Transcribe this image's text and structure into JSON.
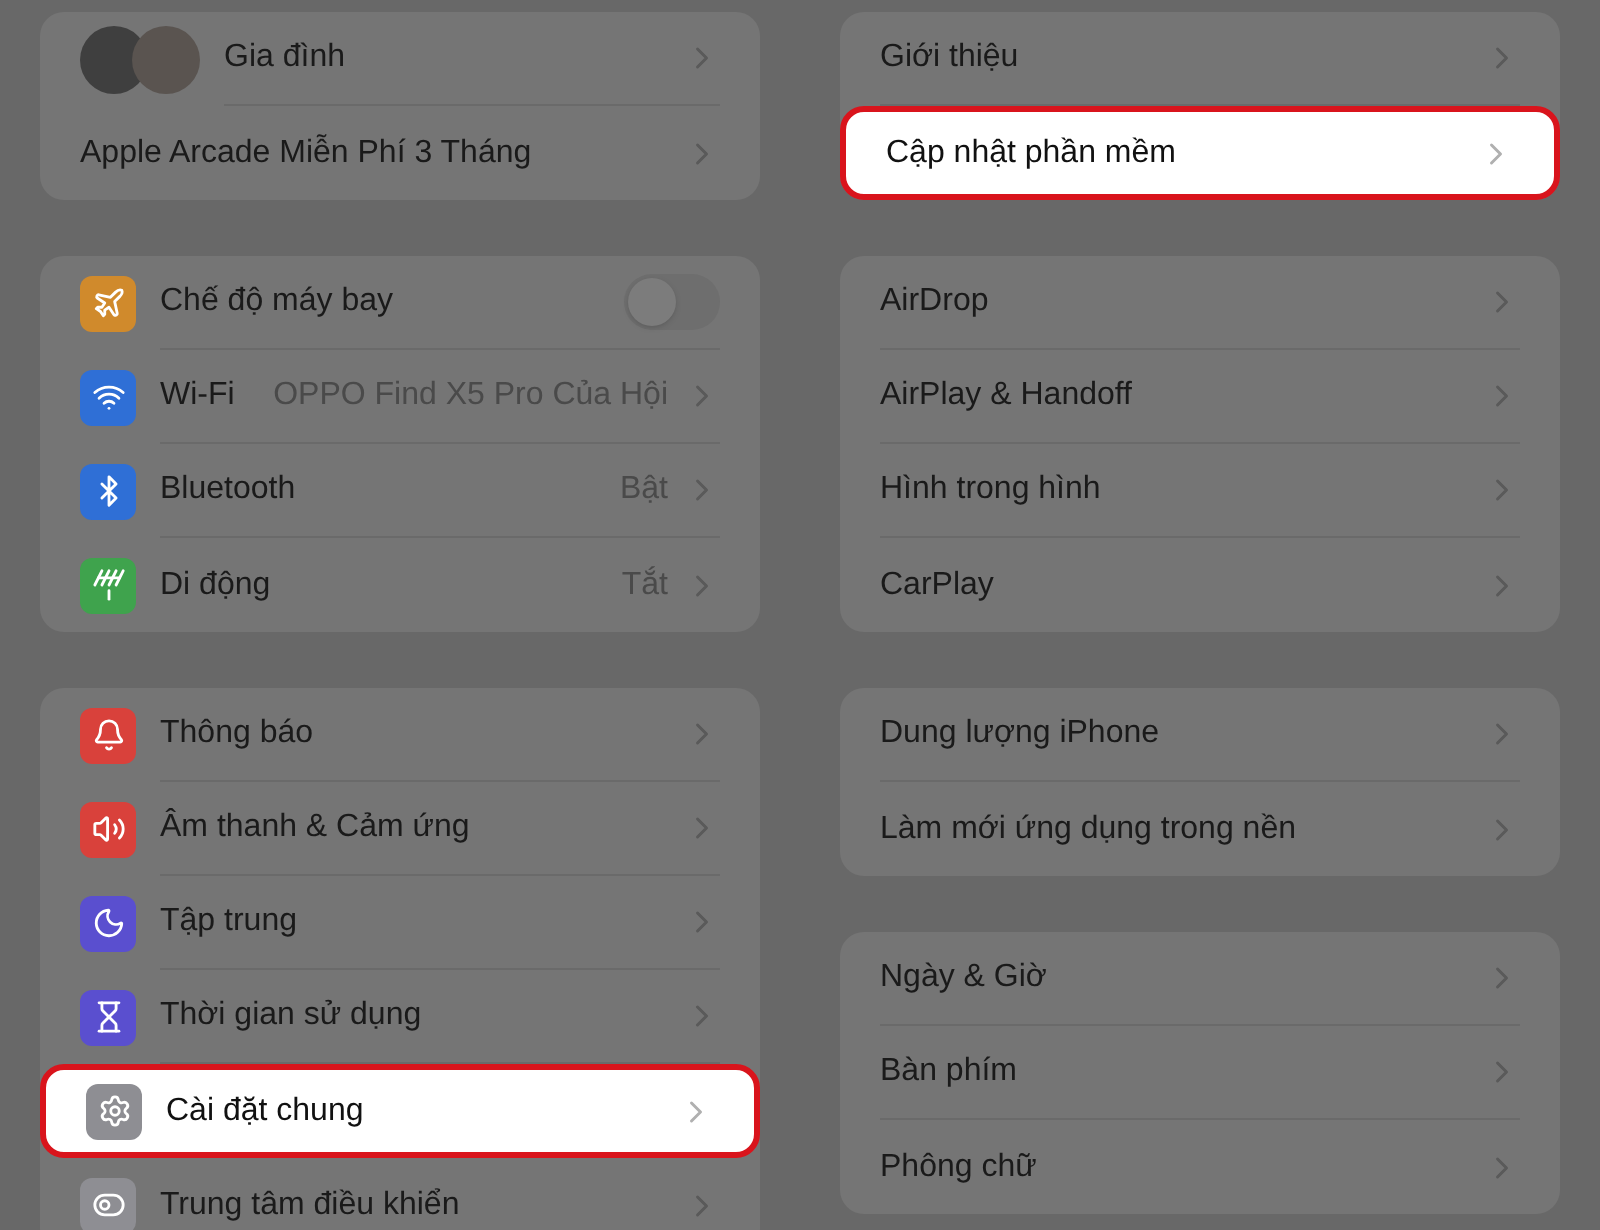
{
  "left_groups": [
    {
      "rows": [
        {
          "kind": "avatars",
          "label": "Gia đình",
          "highlighted": false
        },
        {
          "kind": "plain",
          "label": "Apple Arcade Miễn Phí 3 Tháng",
          "highlighted": false
        }
      ]
    },
    {
      "rows": [
        {
          "kind": "toggle",
          "color": "#d08a2c",
          "label": "Chế độ máy bay",
          "on": false,
          "highlighted": false
        },
        {
          "kind": "icon",
          "color": "#2f6fd6",
          "label": "Wi-Fi",
          "value": "OPPO Find X5 Pro Của Hội",
          "highlighted": false
        },
        {
          "kind": "icon",
          "color": "#2f6fd6",
          "label": "Bluetooth",
          "value": "Bật",
          "highlighted": false
        },
        {
          "kind": "icon",
          "color": "#3fa34d",
          "label": "Di động",
          "value": "Tắt",
          "highlighted": false
        }
      ]
    },
    {
      "rows": [
        {
          "kind": "icon",
          "color": "#d9413b",
          "label": "Thông báo",
          "highlighted": false
        },
        {
          "kind": "icon",
          "color": "#d9413b",
          "label": "Âm thanh & Cảm ứng",
          "highlighted": false
        },
        {
          "kind": "icon",
          "color": "#5a4fcf",
          "label": "Tập trung",
          "highlighted": false
        },
        {
          "kind": "icon",
          "color": "#5a4fcf",
          "label": "Thời gian sử dụng",
          "highlighted": false
        },
        {
          "kind": "icon",
          "color": "#8e8e93",
          "label": "Cài đặt chung",
          "highlighted": true
        },
        {
          "kind": "icon",
          "color": "#8e8e93",
          "label": "Trung tâm điều khiển",
          "highlighted": false
        }
      ]
    }
  ],
  "right_groups": [
    {
      "rows": [
        {
          "kind": "plain",
          "label": "Giới thiệu",
          "highlighted": false
        },
        {
          "kind": "plain",
          "label": "Cập nhật phần mềm",
          "highlighted": true
        }
      ]
    },
    {
      "rows": [
        {
          "kind": "plain",
          "label": "AirDrop",
          "highlighted": false
        },
        {
          "kind": "plain",
          "label": "AirPlay & Handoff",
          "highlighted": false
        },
        {
          "kind": "plain",
          "label": "Hình trong hình",
          "highlighted": false
        },
        {
          "kind": "plain",
          "label": "CarPlay",
          "highlighted": false
        }
      ]
    },
    {
      "rows": [
        {
          "kind": "plain",
          "label": "Dung lượng iPhone",
          "highlighted": false
        },
        {
          "kind": "plain",
          "label": "Làm mới ứng dụng trong nền",
          "highlighted": false
        }
      ]
    },
    {
      "rows": [
        {
          "kind": "plain",
          "label": "Ngày & Giờ",
          "highlighted": false
        },
        {
          "kind": "plain",
          "label": "Bàn phím",
          "highlighted": false
        },
        {
          "kind": "plain",
          "label": "Phông chữ",
          "highlighted": false
        }
      ]
    }
  ]
}
